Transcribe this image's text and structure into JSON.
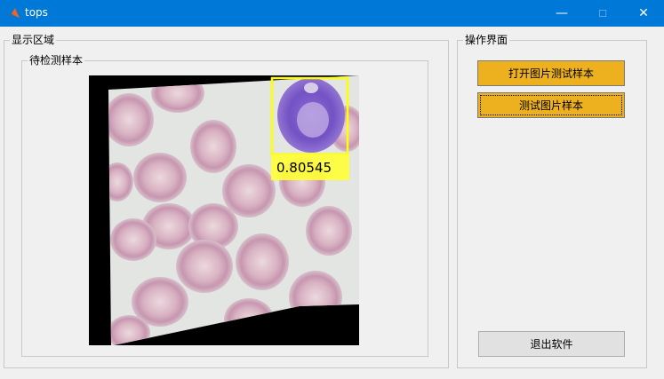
{
  "window": {
    "title": "tops",
    "controls": {
      "minimize": "—",
      "maximize": "☐",
      "close": "✕"
    }
  },
  "display_area": {
    "title": "显示区域",
    "sample_panel": {
      "title": "待检测样本",
      "detection": {
        "score": "0.80545",
        "box_color": "#ffff00"
      }
    }
  },
  "operations": {
    "title": "操作界面",
    "open_button": "打开图片测试样本",
    "test_button": "测试图片样本",
    "exit_button": "退出软件"
  },
  "colors": {
    "accent_button": "#edb120",
    "titlebar": "#0078d7"
  }
}
